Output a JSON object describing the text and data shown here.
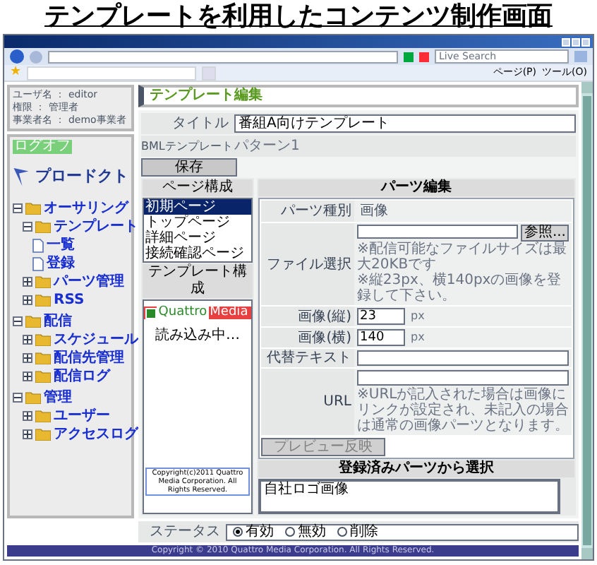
{
  "heading": "テンプレートを利用したコンテンツ制作画面",
  "browser": {
    "search_placeholder": "Live Search",
    "toolbar": [
      "ページ(P)",
      "ツール(O)"
    ]
  },
  "user_info": [
    "ユーザ名 ： editor",
    "権限 ： 管理者",
    "事業者名 ： demo事業者"
  ],
  "favorites_icon": "★",
  "logoff": "ログオフ",
  "logo": "プロードクト",
  "nav": [
    {
      "label": "オーサリング",
      "expanded": true,
      "children": [
        {
          "label": "テンプレート",
          "expanded": true,
          "children": [
            {
              "label": "一覧",
              "kind": "page"
            },
            {
              "label": "登録",
              "kind": "page"
            }
          ]
        },
        {
          "label": "パーツ管理",
          "expanded": false
        },
        {
          "label": "RSS",
          "expanded": false
        }
      ]
    },
    {
      "label": "配信",
      "expanded": true,
      "children": [
        {
          "label": "スケジュール",
          "expanded": false
        },
        {
          "label": "配信先管理",
          "expanded": false
        },
        {
          "label": "配信ログ",
          "expanded": false
        }
      ]
    },
    {
      "label": "管理",
      "expanded": true,
      "children": [
        {
          "label": "ユーザー",
          "expanded": false
        },
        {
          "label": "アクセスログ",
          "expanded": false
        }
      ]
    }
  ],
  "page_title": "テンプレート編集",
  "form": {
    "title_label": "タイトル",
    "title_value": "番組A向けテンプレート",
    "bml_label": "BMLテンプレート",
    "bml_value": "パターン1",
    "save": "保存"
  },
  "page_structure": {
    "heading": "ページ構成",
    "items": [
      {
        "label": "初期ページ",
        "selected": true
      },
      {
        "label": "トップページ",
        "selected": false
      },
      {
        "label": "詳細ページ",
        "selected": false
      },
      {
        "label": "接続確認ページ",
        "selected": false
      }
    ]
  },
  "template_structure": {
    "heading": "テンプレート構成",
    "logo_a": "Quattro",
    "logo_b": "Media",
    "loading": "読み込み中…",
    "copyright": "Copyright(c)2011 Quattro Media Corporation. All Rights Reserved."
  },
  "parts_edit": {
    "heading": "パーツ編集",
    "type_label": "パーツ種別",
    "type_value": "画像",
    "file_label": "ファイル選択",
    "browse": "参照...",
    "file_notes": [
      "※配信可能なファイルサイズは最大20KBです",
      "※縦23px、横140pxの画像を登録して下さい。"
    ],
    "height_label": "画像(縦)",
    "height_value": "23",
    "height_unit": "px",
    "width_label": "画像(横)",
    "width_value": "140",
    "width_unit": "px",
    "alt_label": "代替テキスト",
    "url_label": "URL",
    "url_note": "※URLが記入された場合は画像にリンクが設定され、未記入の場合は通常の画像パーツとなります。",
    "preview": "プレビュー反映",
    "preview_disabled": true
  },
  "registered_parts": {
    "heading": "登録済みパーツから選択",
    "items": [
      "自社ロゴ画像"
    ]
  },
  "status": {
    "label": "ステータス",
    "options": [
      {
        "label": "有効",
        "selected": true
      },
      {
        "label": "無効",
        "selected": false
      },
      {
        "label": "削除",
        "selected": false
      }
    ]
  },
  "footer": "Copyright © 2010 Quattro Media Corporation. All Rights Reserved."
}
